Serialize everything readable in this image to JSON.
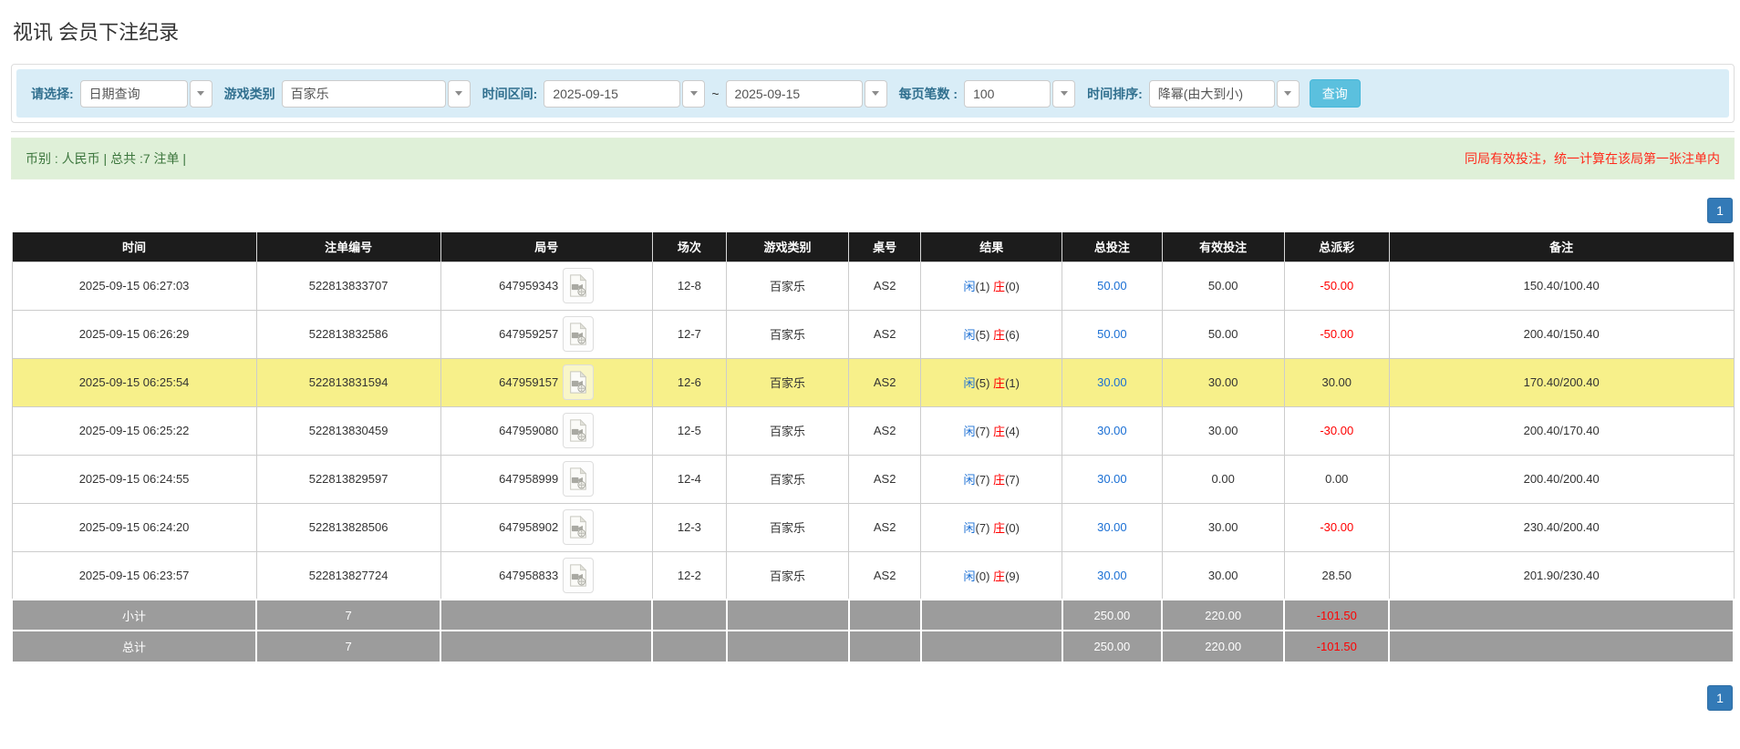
{
  "page": {
    "title": "视讯 会员下注纪录"
  },
  "filters": {
    "select_label": "请选择:",
    "select_value": "日期查询",
    "game_label": "游戏类别",
    "game_value": "百家乐",
    "range_label": "时间区间:",
    "date_from": "2025-09-15",
    "tilde": "~",
    "date_to": "2025-09-15",
    "size_label": "每页笔数 :",
    "size_value": "100",
    "sort_label": "时间排序:",
    "sort_value": "降幂(由大到小)",
    "search_button": "查询"
  },
  "summary": {
    "left_text": "币别 : 人民币 | 总共 :7 注单 |",
    "right_note": "同局有效投注，统一计算在该局第一张注单内"
  },
  "pagination": {
    "page": "1"
  },
  "colors": {
    "accent_blue": "#1a6fd4",
    "negative_red": "#ff0000",
    "highlight_yellow": "#f7f08a",
    "header_black": "#1c1c1c",
    "summary_gray": "#9c9c9c",
    "filter_bg": "#d9edf7",
    "success_bg": "#dff0d8",
    "search_btn": "#5bc0de",
    "pager_blue": "#337ab7"
  },
  "table": {
    "headers": [
      "时间",
      "注单编号",
      "局号",
      "场次",
      "游戏类别",
      "桌号",
      "结果",
      "总投注",
      "有效投注",
      "总派彩",
      "备注"
    ],
    "rows": [
      {
        "time": "2025-09-15 06:27:03",
        "bet_id": "522813833707",
        "round_id": "647959343",
        "session": "12-8",
        "game": "百家乐",
        "table_no": "AS2",
        "result": {
          "p_label": "闲",
          "p_val": "(1)",
          "b_label": "庄",
          "b_val": "(0)"
        },
        "total_bet": "50.00",
        "valid_bet": "50.00",
        "payout": "-50.00",
        "payout_negative": true,
        "remark": "150.40/100.40",
        "highlight": false
      },
      {
        "time": "2025-09-15 06:26:29",
        "bet_id": "522813832586",
        "round_id": "647959257",
        "session": "12-7",
        "game": "百家乐",
        "table_no": "AS2",
        "result": {
          "p_label": "闲",
          "p_val": "(5)",
          "b_label": "庄",
          "b_val": "(6)"
        },
        "total_bet": "50.00",
        "valid_bet": "50.00",
        "payout": "-50.00",
        "payout_negative": true,
        "remark": "200.40/150.40",
        "highlight": false
      },
      {
        "time": "2025-09-15 06:25:54",
        "bet_id": "522813831594",
        "round_id": "647959157",
        "session": "12-6",
        "game": "百家乐",
        "table_no": "AS2",
        "result": {
          "p_label": "闲",
          "p_val": "(5)",
          "b_label": "庄",
          "b_val": "(1)"
        },
        "total_bet": "30.00",
        "valid_bet": "30.00",
        "payout": "30.00",
        "payout_negative": false,
        "remark": "170.40/200.40",
        "highlight": true
      },
      {
        "time": "2025-09-15 06:25:22",
        "bet_id": "522813830459",
        "round_id": "647959080",
        "session": "12-5",
        "game": "百家乐",
        "table_no": "AS2",
        "result": {
          "p_label": "闲",
          "p_val": "(7)",
          "b_label": "庄",
          "b_val": "(4)"
        },
        "total_bet": "30.00",
        "valid_bet": "30.00",
        "payout": "-30.00",
        "payout_negative": true,
        "remark": "200.40/170.40",
        "highlight": false
      },
      {
        "time": "2025-09-15 06:24:55",
        "bet_id": "522813829597",
        "round_id": "647958999",
        "session": "12-4",
        "game": "百家乐",
        "table_no": "AS2",
        "result": {
          "p_label": "闲",
          "p_val": "(7)",
          "b_label": "庄",
          "b_val": "(7)"
        },
        "total_bet": "30.00",
        "valid_bet": "0.00",
        "payout": "0.00",
        "payout_negative": false,
        "remark": "200.40/200.40",
        "highlight": false
      },
      {
        "time": "2025-09-15 06:24:20",
        "bet_id": "522813828506",
        "round_id": "647958902",
        "session": "12-3",
        "game": "百家乐",
        "table_no": "AS2",
        "result": {
          "p_label": "闲",
          "p_val": "(7)",
          "b_label": "庄",
          "b_val": "(0)"
        },
        "total_bet": "30.00",
        "valid_bet": "30.00",
        "payout": "-30.00",
        "payout_negative": true,
        "remark": "230.40/200.40",
        "highlight": false
      },
      {
        "time": "2025-09-15 06:23:57",
        "bet_id": "522813827724",
        "round_id": "647958833",
        "session": "12-2",
        "game": "百家乐",
        "table_no": "AS2",
        "result": {
          "p_label": "闲",
          "p_val": "(0)",
          "b_label": "庄",
          "b_val": "(9)"
        },
        "total_bet": "30.00",
        "valid_bet": "30.00",
        "payout": "28.50",
        "payout_negative": false,
        "remark": "201.90/230.40",
        "highlight": false
      }
    ],
    "subtotal": {
      "label": "小计",
      "count": "7",
      "total_bet": "250.00",
      "valid_bet": "220.00",
      "payout": "-101.50",
      "payout_negative": true
    },
    "total": {
      "label": "总计",
      "count": "7",
      "total_bet": "250.00",
      "valid_bet": "220.00",
      "payout": "-101.50",
      "payout_negative": true
    }
  }
}
